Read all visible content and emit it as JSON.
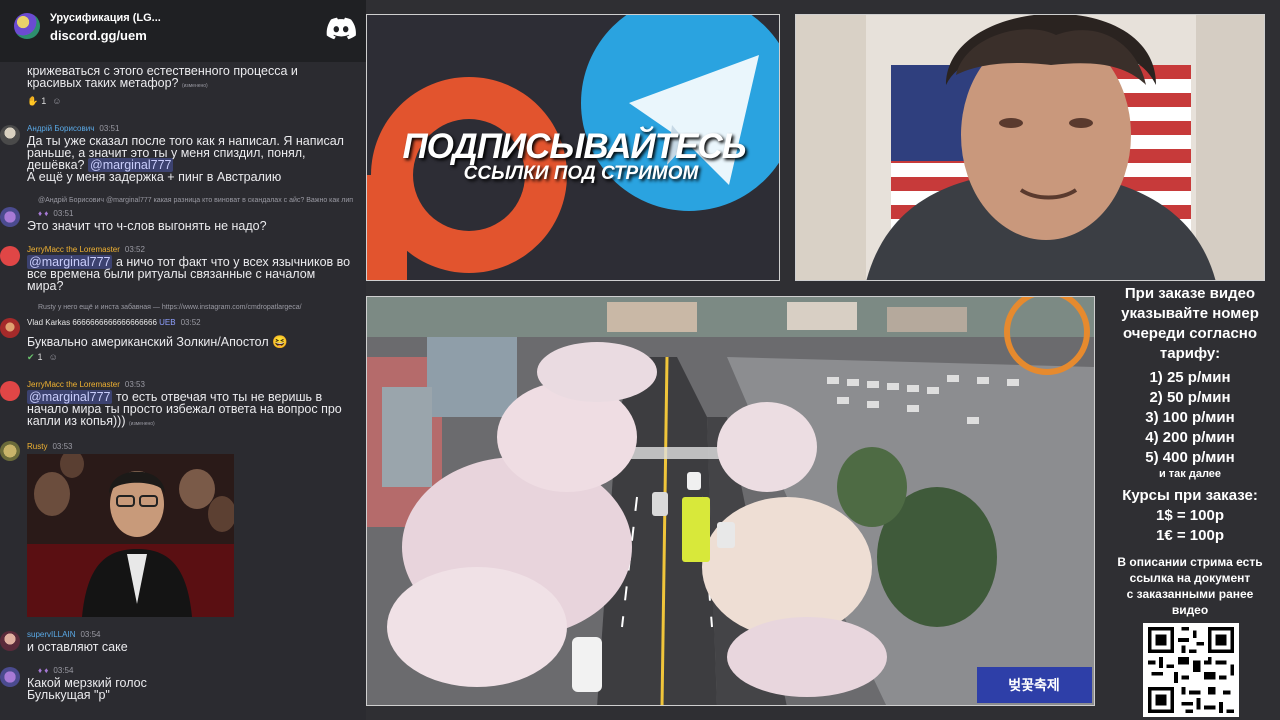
{
  "discord": {
    "server_name": "Урусификация (LG...",
    "server_link": "discord.gg/uem"
  },
  "chat": {
    "messages": [
      {
        "lines": [
          "крижеваться с этого естественного процесса и",
          "красивых таких метафор?"
        ],
        "edited": "(изменено)",
        "reactions": [
          {
            "icon": "hand-emoji",
            "count": "1"
          },
          {
            "icon": "add-reaction",
            "count": ""
          }
        ]
      },
      {
        "author": "Андрій Борисович",
        "time": "03:51",
        "lines": [
          "Да ты уже сказал после того как я написал. Я написал",
          "раньше, а значит это ты у меня спиздил, понял,"
        ],
        "line3_text": "дешёвка? ",
        "line3_mention": "@marginal777",
        "line4": "А ещё у меня задержка + пинг в Австралию"
      },
      {
        "reply": "@Андрій Борисович  @marginal777 какая разница кто виноват в скандалах с айс? Важно как лип",
        "time": "03:51",
        "lines": [
          "Это значит что ч-слов выгонять не надо?"
        ]
      },
      {
        "author": "JerryMacc the Loremaster",
        "time": "03:52",
        "mention": "@marginal777",
        "line1_rest": " а ничо тот факт что у всех язычников во",
        "lines": [
          "все времена были ритуалы связанные с началом",
          "мира?"
        ]
      },
      {
        "reply": "Rustу у него ещё и инста забавная — https://www.instagram.com/cmdropatlargeca/",
        "author": "Vlad Karkas 6666666666666666666",
        "badge": "UEB",
        "time": "03:52",
        "lines": [
          "Буквально американский Золкин/Апостол"
        ],
        "reactions": [
          {
            "icon": "check-emoji",
            "count": "1"
          },
          {
            "icon": "add-reaction",
            "count": ""
          }
        ]
      },
      {
        "author": "JerryMacc the Loremaster",
        "time": "03:53",
        "mention": "@marginal777",
        "line1_rest": " то есть отвечая что ты не веришь в",
        "lines": [
          "начало мира ты просто избежал ответа на вопрос про",
          "капли из копья)))"
        ],
        "edited": "(изменено)"
      },
      {
        "author": "Rustу",
        "time": "03:53"
      },
      {
        "author": "supervILLAIN",
        "time": "03:54",
        "lines": [
          "и оставляют саке"
        ]
      },
      {
        "time": "03:54",
        "lines": [
          "Какой мерзкий голос",
          "Булькущая \"р\""
        ]
      }
    ]
  },
  "promo": {
    "title": "ПОДПИСЫВАЙТЕСЬ",
    "subtitle": "ССЫЛКИ ПОД СТРИМОМ"
  },
  "video": {
    "sign_text": "벚꽃축제"
  },
  "info": {
    "order_note": [
      "При заказе видео",
      "указывайте номер",
      "очереди согласно",
      "тарифу:"
    ],
    "tariffs": [
      "1) 25 р/мин",
      "2) 50 р/мин",
      "3) 100 р/мин",
      "4) 200 р/мин",
      "5) 400 р/мин"
    ],
    "tariff_more": "и так далее",
    "rates_title": "Курсы при заказе:",
    "rates": [
      "1$ = 100р",
      "1€ = 100р"
    ],
    "doc_note": [
      "В описании стрима есть",
      "ссылка на документ",
      "с заказанными ранее",
      "видео"
    ]
  },
  "colors": {
    "chat_bg": "#2b2b30",
    "author_gold": "#f0b232",
    "author_blue": "#5aa9e6",
    "mention_bg": "#3c4270",
    "discord_blurple": "#ffffff",
    "patreon_orange": "#e2542e",
    "telegram_blue": "#2aa3e0"
  }
}
